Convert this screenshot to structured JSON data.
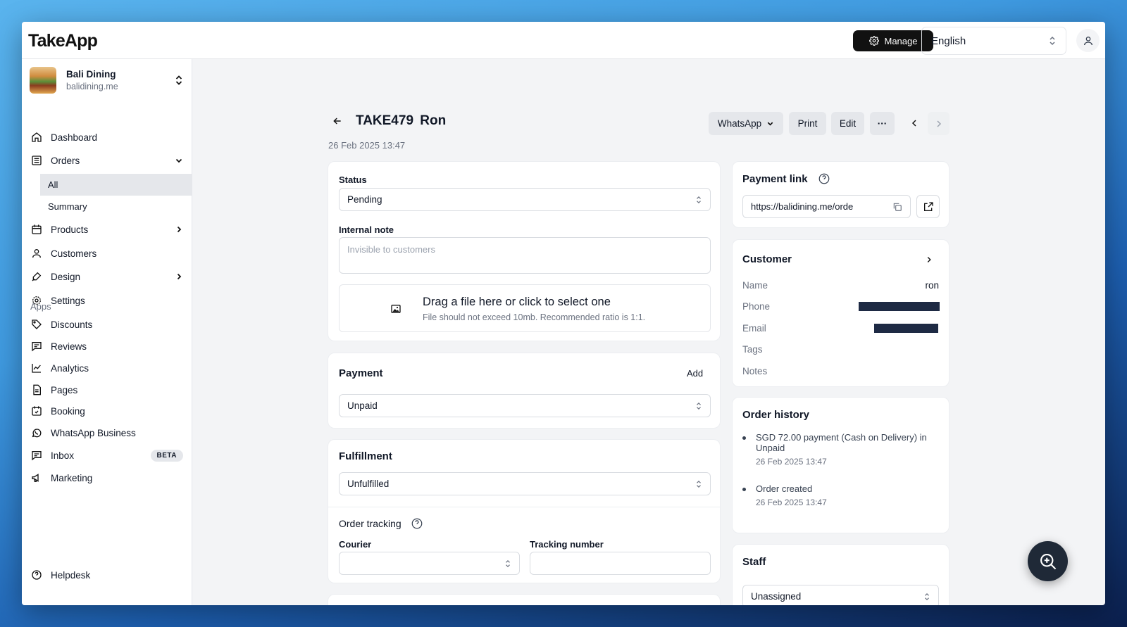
{
  "app": {
    "logo": "TakeApp",
    "manage_label": "Manage",
    "language": "English"
  },
  "store": {
    "name": "Bali Dining",
    "url": "balidining.me"
  },
  "nav": {
    "dashboard": "Dashboard",
    "orders": "Orders",
    "orders_all": "All",
    "orders_summary": "Summary",
    "products": "Products",
    "customers": "Customers",
    "design": "Design",
    "settings": "Settings",
    "apps_label": "Apps",
    "discounts": "Discounts",
    "reviews": "Reviews",
    "analytics": "Analytics",
    "pages": "Pages",
    "booking": "Booking",
    "whatsapp_business": "WhatsApp Business",
    "inbox": "Inbox",
    "inbox_badge": "BETA",
    "marketing": "Marketing",
    "helpdesk": "Helpdesk"
  },
  "order": {
    "id": "TAKE479",
    "customer_name": "Ron",
    "date": "26 Feb 2025 13:47",
    "actions": {
      "whatsapp": "WhatsApp",
      "print": "Print",
      "edit": "Edit",
      "more": "···"
    }
  },
  "status_card": {
    "status_label": "Status",
    "status_value": "Pending",
    "note_label": "Internal note",
    "note_placeholder": "Invisible to customers",
    "drop_title": "Drag a file here or click to select one",
    "drop_hint": "File should not exceed 10mb. Recommended ratio is 1:1."
  },
  "payment_card": {
    "title": "Payment",
    "add_label": "Add",
    "value": "Unpaid"
  },
  "fulfillment_card": {
    "title": "Fulfillment",
    "value": "Unfulfilled",
    "tracking_title": "Order tracking",
    "courier_label": "Courier",
    "tracking_label": "Tracking number"
  },
  "payment_link": {
    "title": "Payment link",
    "url": "https://balidining.me/orde"
  },
  "customer_card": {
    "title": "Customer",
    "name_key": "Name",
    "name_value": "ron",
    "phone_key": "Phone",
    "email_key": "Email",
    "tags_key": "Tags",
    "notes_key": "Notes"
  },
  "history": {
    "title": "Order history",
    "items": [
      {
        "text": "SGD 72.00 payment (Cash on Delivery) in Unpaid",
        "date": "26 Feb 2025 13:47"
      },
      {
        "text": "Order created",
        "date": "26 Feb 2025 13:47"
      }
    ]
  },
  "staff": {
    "title": "Staff",
    "value": "Unassigned"
  },
  "colors": {
    "accent": "#111111",
    "redaction": "#1e2a44"
  }
}
